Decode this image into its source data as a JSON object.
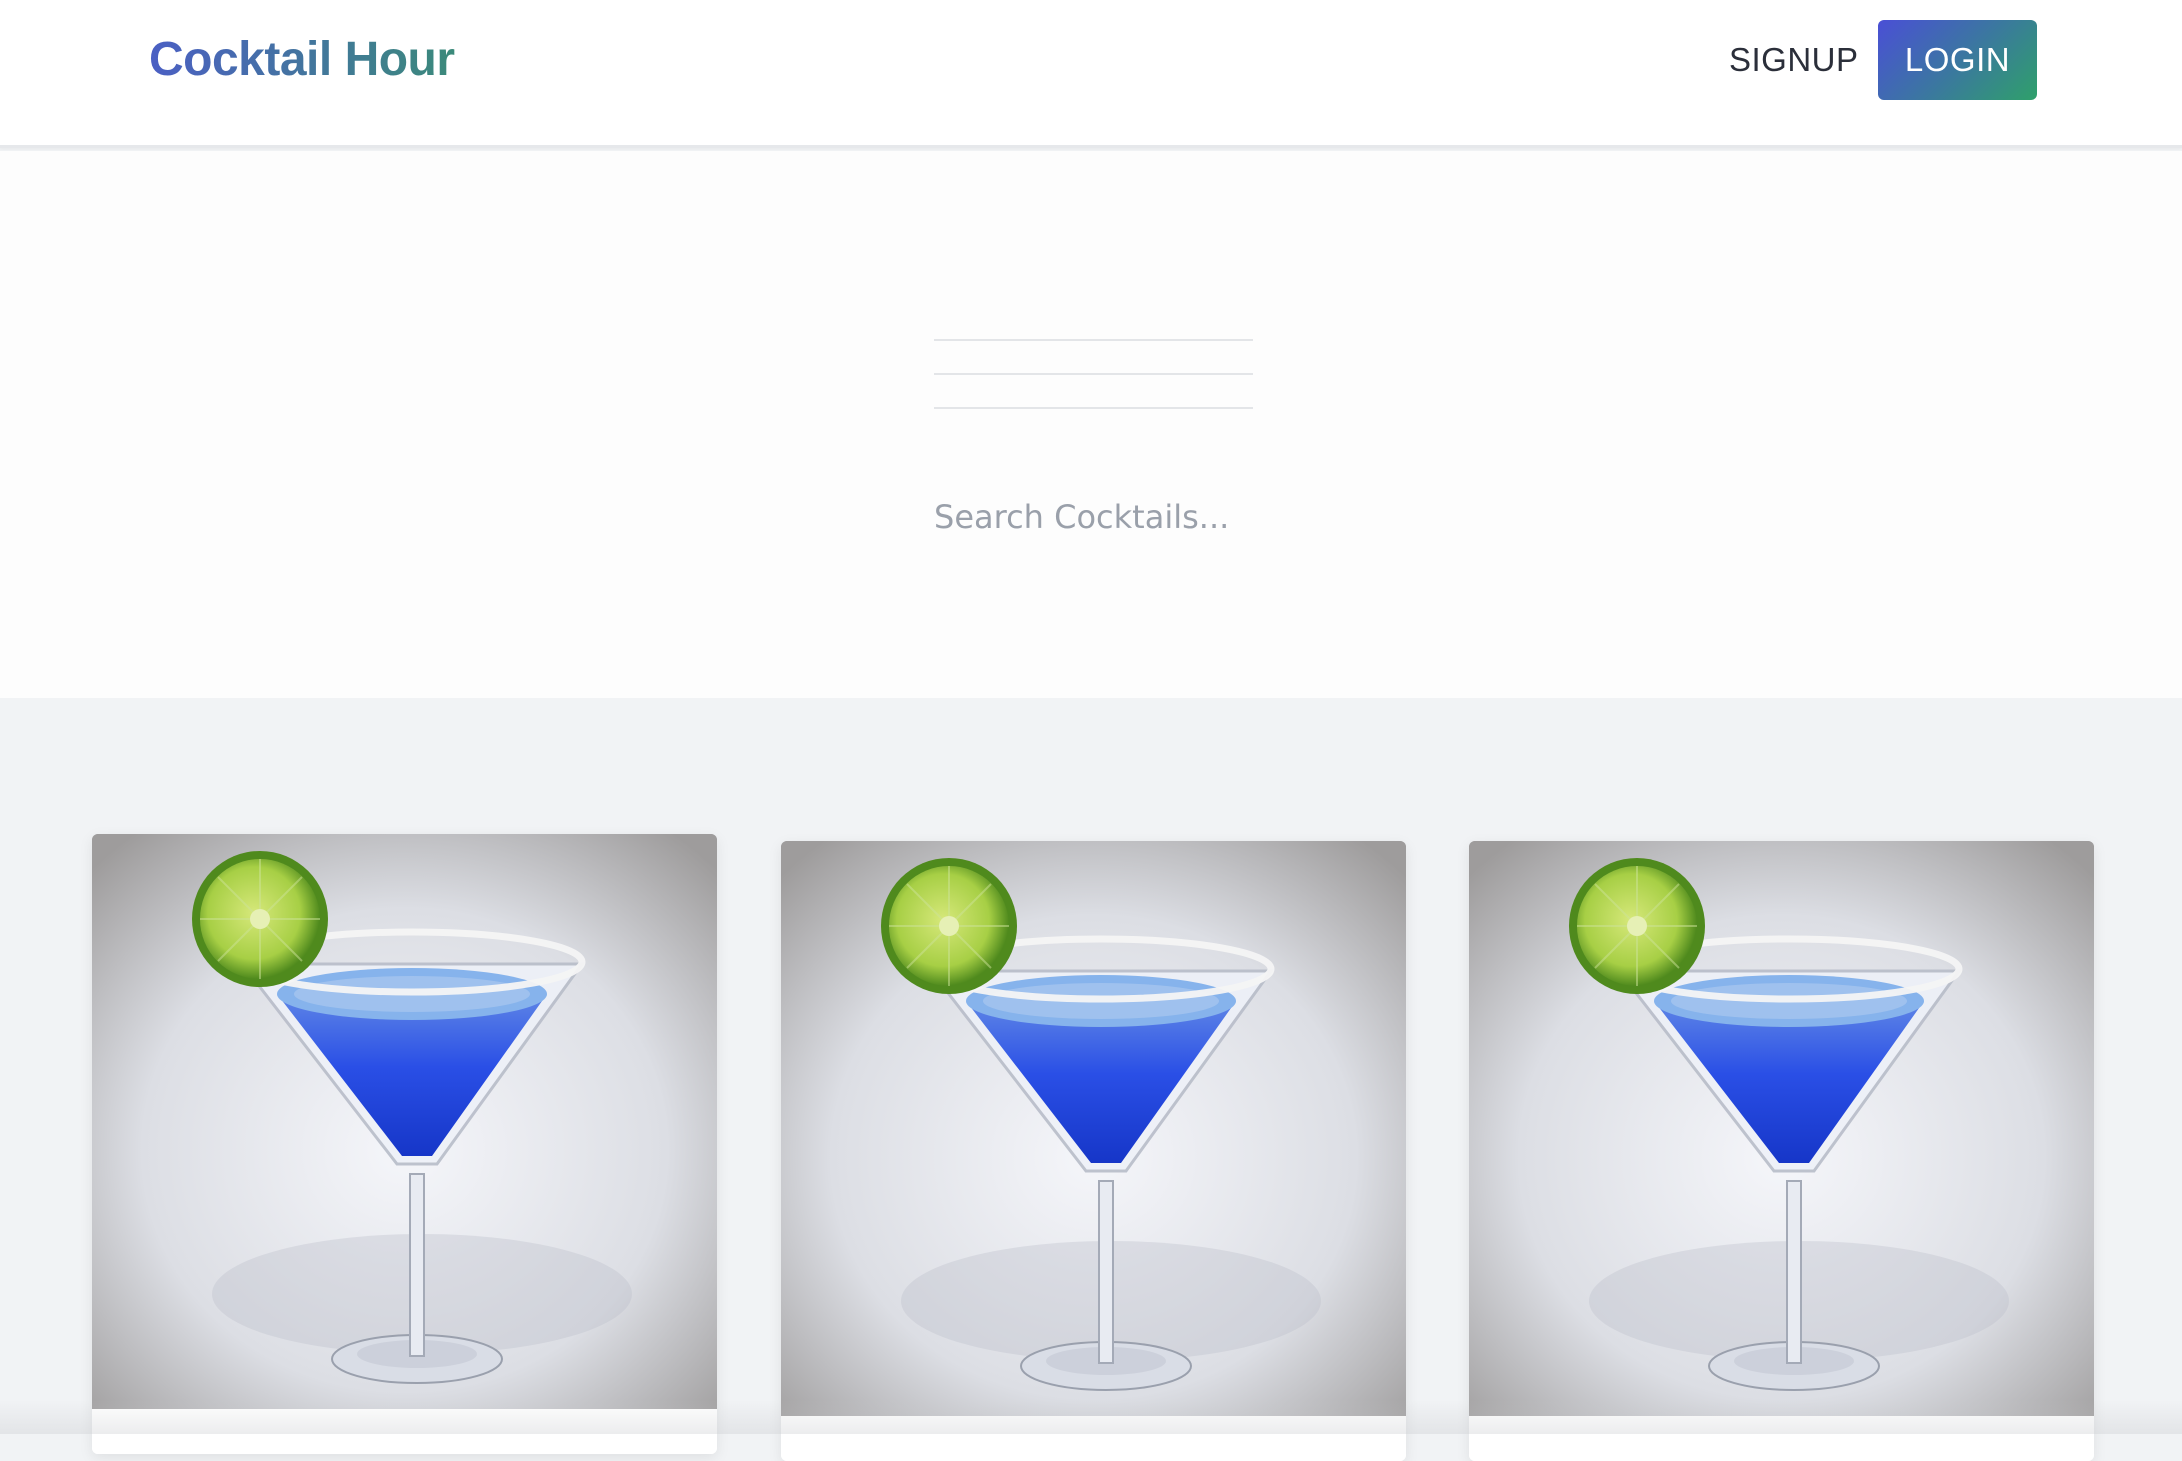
{
  "header": {
    "brand": "Cocktail Hour",
    "signup_label": "SIGNUP",
    "login_label": "LOGIN"
  },
  "search": {
    "placeholder": "Search Cocktails...",
    "value": ""
  },
  "cards": [
    {
      "image_alt": "blue cocktail with lime"
    },
    {
      "image_alt": "blue cocktail with lime"
    },
    {
      "image_alt": "blue cocktail with lime"
    }
  ],
  "colors": {
    "brand_gradient_start": "#4b5fc4",
    "brand_gradient_end": "#3b8a7a",
    "login_gradient_start": "#4a4fd6",
    "login_gradient_end": "#2fa06a",
    "cocktail_blue": "#1f4fe0",
    "lime_green": "#8cc63f"
  }
}
